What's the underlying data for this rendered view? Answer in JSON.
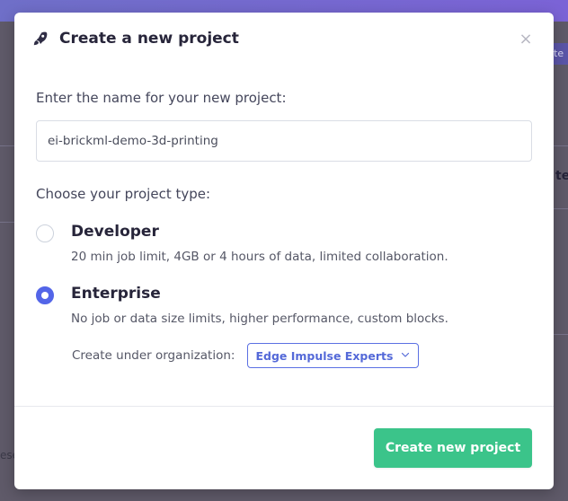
{
  "modal": {
    "title": "Create a new project",
    "close_label": "×"
  },
  "form": {
    "name_label": "Enter the name for your new project:",
    "name_value": "ei-brickml-demo-3d-printing",
    "type_label": "Choose your project type:",
    "project_types": [
      {
        "title": "Developer",
        "description": "20 min job limit, 4GB or 4 hours of data, limited collaboration.",
        "selected": false
      },
      {
        "title": "Enterprise",
        "description": "No job or data size limits, higher performance, custom blocks.",
        "selected": true
      }
    ],
    "organization_label": "Create under organization:",
    "organization_value": "Edge Impulse Experts"
  },
  "actions": {
    "create_label": "Create new project"
  },
  "background": {
    "right_button_text": "te",
    "right_heading_text": "ter",
    "left_text": "ese"
  },
  "icons": {
    "header": "rocket-icon",
    "close": "close-icon",
    "dropdown": "chevron-down-icon"
  },
  "colors": {
    "accent": "#5365e8",
    "success": "#3bc48a",
    "text_dark": "#27253a"
  }
}
